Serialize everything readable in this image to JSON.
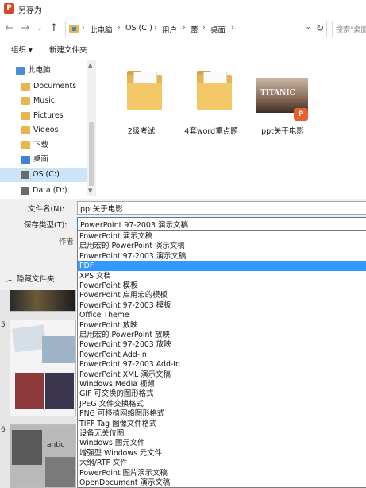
{
  "window": {
    "title": "另存为",
    "app_icon": "P"
  },
  "nav": {
    "back": "←",
    "forward": "→",
    "recent": "⌄",
    "up": "↑",
    "breadcrumbs": [
      "此电脑",
      "OS (C:)",
      "用户",
      "蕾",
      "桌面"
    ],
    "separator": "›",
    "dropdown": "⌄",
    "refresh": "↻",
    "search_placeholder": "搜索\"桌面\""
  },
  "toolbar": {
    "organize": "组织 ▾",
    "new_folder": "新建文件夹"
  },
  "sidebar": {
    "items": [
      {
        "label": "此电脑",
        "icon": "computer-icon",
        "color": "#4a8fd6"
      },
      {
        "label": "Documents",
        "icon": "documents-folder-icon",
        "color": "#e8b64c"
      },
      {
        "label": "Music",
        "icon": "music-folder-icon",
        "color": "#e8b64c"
      },
      {
        "label": "Pictures",
        "icon": "pictures-folder-icon",
        "color": "#e8b64c"
      },
      {
        "label": "Videos",
        "icon": "videos-folder-icon",
        "color": "#e8b64c"
      },
      {
        "label": "下载",
        "icon": "downloads-folder-icon",
        "color": "#e8b64c"
      },
      {
        "label": "桌面",
        "icon": "desktop-folder-icon",
        "color": "#3f83d4"
      },
      {
        "label": "OS (C:)",
        "icon": "drive-icon",
        "color": "#6b6b6b"
      },
      {
        "label": "Data (D:)",
        "icon": "drive-icon",
        "color": "#6b6b6b"
      }
    ],
    "selected_index": 7
  },
  "files": [
    {
      "name": "2级考试",
      "type": "folder"
    },
    {
      "name": "4套word重点题",
      "type": "folder"
    },
    {
      "name": "ppt关于电影",
      "type": "pptx",
      "thumb_text": "TITANIC",
      "badge": "P"
    }
  ],
  "form": {
    "filename_label": "文件名(N):",
    "filename_value": "ppt关于电影",
    "filetype_label": "保存类型(T):",
    "filetype_value": "PowerPoint 97-2003 演示文稿",
    "author_label": "作者:",
    "hide_folders": "隐藏文件夹"
  },
  "file_types": [
    "PowerPoint 演示文稿",
    "启用宏的 PowerPoint 演示文稿",
    "PowerPoint 97-2003 演示文稿",
    "PDF",
    "XPS 文档",
    "PowerPoint 模板",
    "PowerPoint 启用宏的模板",
    "PowerPoint 97-2003 模板",
    "Office Theme",
    "PowerPoint 放映",
    "启用宏的 PowerPoint 放映",
    "PowerPoint 97-2003 放映",
    "PowerPoint Add-In",
    "PowerPoint 97-2003 Add-In",
    "PowerPoint XML 演示文稿",
    "Windows Media 视频",
    "GIF 可交换的图形格式",
    "JPEG 文件交换格式",
    "PNG 可移植网络图形格式",
    "TIFF Tag 图像文件格式",
    "设备无关位图",
    "Windows 图元文件",
    "增强型 Windows 元文件",
    "大纲/RTF 文件",
    "PowerPoint 图片演示文稿",
    "OpenDocument 演示文稿"
  ],
  "highlighted_type_index": 3,
  "background": {
    "slide_numbers": [
      "5",
      "6"
    ],
    "thumb_text": "antic"
  },
  "colors": {
    "highlight": "#3399ff",
    "selection": "#cce4f7",
    "accent": "#d24726"
  }
}
